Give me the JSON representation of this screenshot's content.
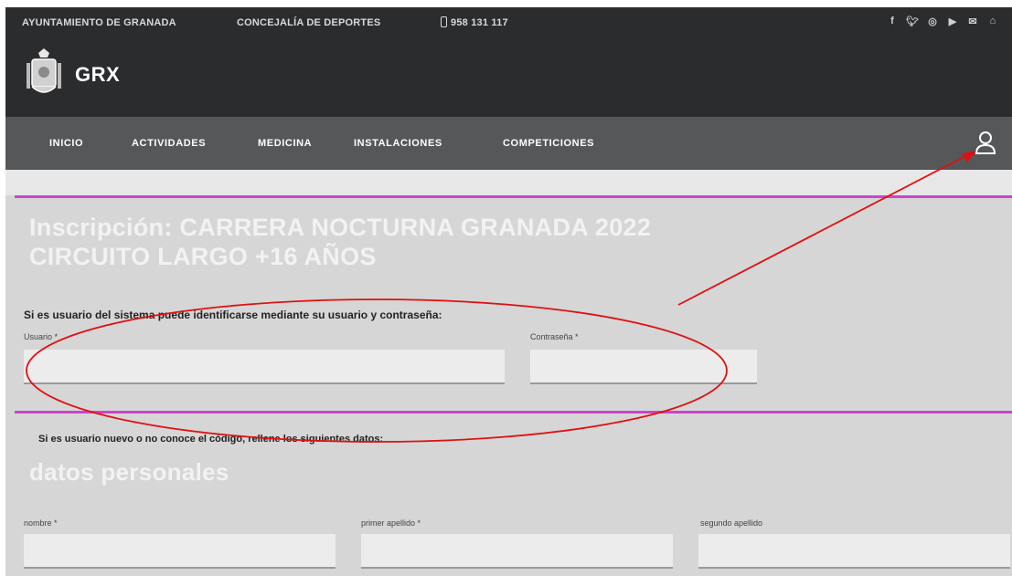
{
  "topbar": {
    "ayuntamiento": "AYUNTAMIENTO DE GRANADA",
    "concejalia": "CONCEJALÍA DE DEPORTES",
    "phone": "958 131 117",
    "social_icons": [
      "facebook-icon",
      "twitter-icon",
      "instagram-icon",
      "youtube-icon",
      "mail-icon",
      "home-icon"
    ]
  },
  "logo": {
    "text": "GRX",
    "crest_icon": "granada-crest-icon"
  },
  "nav": {
    "items": [
      "INICIO",
      "ACTIVIDADES",
      "MEDICINA",
      "INSTALACIONES",
      "COMPETICIONES"
    ],
    "user_icon": "user-icon"
  },
  "page": {
    "title_line1": "Inscripción: CARRERA NOCTURNA GRANADA 2022",
    "title_line2": "CIRCUITO LARGO +16 AÑOS",
    "login_prompt": "Si es usuario del sistema puede identificarse mediante su usuario y contraseña:",
    "usuario_label": "Usuario *",
    "contrasena_label": "Contraseña *",
    "new_user_prompt": "Si es usuario nuevo o no conoce el código, rellene los siguientes datos:",
    "personal_heading": "datos personales",
    "nombre_label": "nombre *",
    "primer_apellido_label": "primer apellido *",
    "segundo_apellido_label": "segundo apellido"
  },
  "colors": {
    "dark_bar": "#2b2c2e",
    "nav_bar": "#565759",
    "content_bg": "#d6d6d6",
    "divider": "#cc44cc",
    "annotation": "#e01010"
  }
}
